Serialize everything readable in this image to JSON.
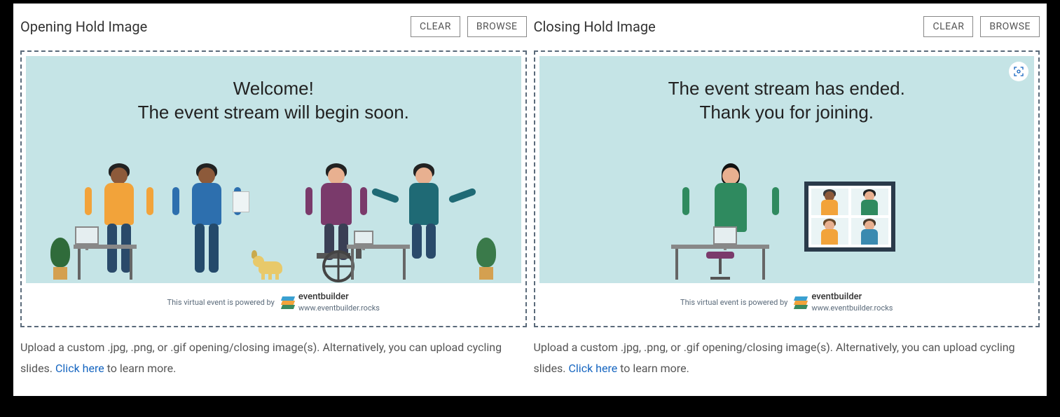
{
  "opening": {
    "title": "Opening Hold Image",
    "clear": "CLEAR",
    "browse": "BROWSE",
    "preview_line1": "Welcome!",
    "preview_line2": "The event stream will begin soon.",
    "footer_powered": "This virtual event is powered by",
    "footer_brand": "eventbuilder",
    "footer_url": "www.eventbuilder.rocks",
    "helper_pre": "Upload a custom .jpg, .png, or .gif opening/closing image(s). Alternatively, you can upload cycling slides. ",
    "helper_link": "Click here",
    "helper_post": " to learn more."
  },
  "closing": {
    "title": "Closing Hold Image",
    "clear": "CLEAR",
    "browse": "BROWSE",
    "preview_line1": "The event stream has ended.",
    "preview_line2": "Thank you for joining.",
    "footer_powered": "This virtual event is powered by",
    "footer_brand": "eventbuilder",
    "footer_url": "www.eventbuilder.rocks",
    "helper_pre": "Upload a custom .jpg, .png, or .gif opening/closing image(s). Alternatively, you can upload cycling slides. ",
    "helper_link": "Click here",
    "helper_post": " to learn more."
  }
}
